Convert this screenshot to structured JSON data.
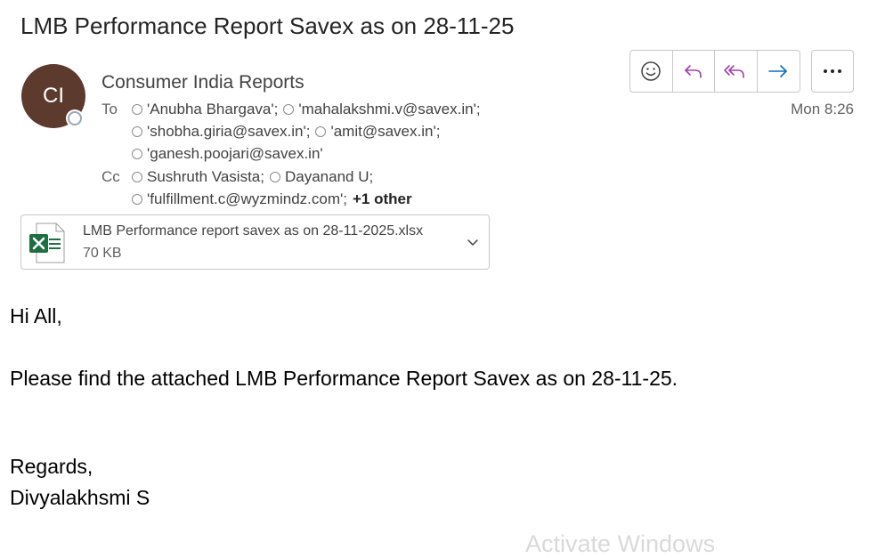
{
  "message": {
    "subject": "LMB Performance Report Savex as on 28-11-25",
    "sender": {
      "initials": "CI",
      "name": "Consumer India Reports",
      "avatar_color": "#5c3a2e"
    },
    "to_label": "To",
    "cc_label": "Cc",
    "to": [
      "'Anubha Bhargava';",
      "'mahalakshmi.v@savex.in';",
      "'shobha.giria@savex.in';",
      "'amit@savex.in';",
      "'ganesh.poojari@savex.in'"
    ],
    "cc": [
      "Sushruth Vasista;",
      "Dayanand U;",
      "'fulfillment.c@wyzmindz.com';"
    ],
    "cc_more": "+1 other",
    "timestamp": "Mon 8:26"
  },
  "toolbar": {
    "buttons": [
      "emoji-icon",
      "reply-icon",
      "reply-all-icon",
      "forward-icon"
    ],
    "more": "more-icon",
    "accent_color": "#a23fae",
    "forward_color": "#0f6cbd"
  },
  "attachment": {
    "name": "LMB Performance report savex as on 28-11-2025.xlsx",
    "size": "70 KB",
    "icon": "excel-file-icon",
    "icon_color": "#1d6f42"
  },
  "body": {
    "greeting": "Hi All,",
    "line1": "Please find the attached LMB Performance Report Savex as on 28-11-25.",
    "closing": "Regards,",
    "signature": "Divyalakhsmi S"
  },
  "watermark": "Activate Windows"
}
